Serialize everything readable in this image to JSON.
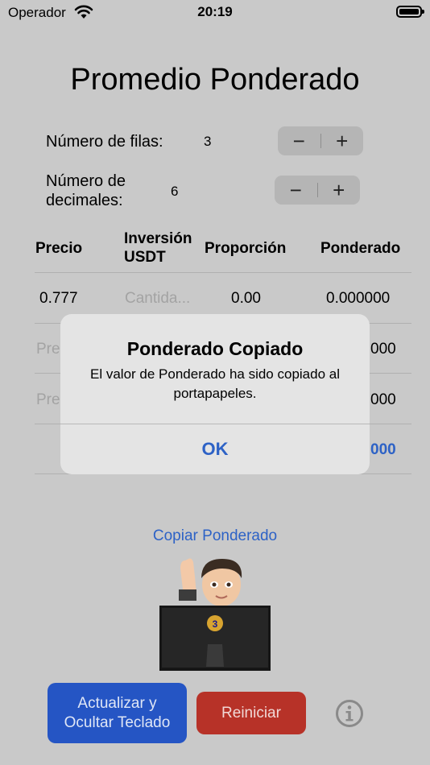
{
  "status_bar": {
    "carrier": "Operador",
    "time": "20:19",
    "wifi_icon": "wifi-icon",
    "battery_icon": "battery-icon"
  },
  "title": "Promedio Ponderado",
  "rows_setting": {
    "label": "Número de filas:",
    "value": "3",
    "minus": "−",
    "plus": "+"
  },
  "decimals_setting": {
    "label_line1": "Número de",
    "label_line2": "decimales:",
    "value": "6",
    "minus": "−",
    "plus": "+"
  },
  "table": {
    "headers": {
      "precio": "Precio",
      "inversion_line1": "Inversión",
      "inversion_line2": "USDT",
      "proporcion": "Proporción",
      "ponderado": "Ponderado"
    },
    "row1": {
      "precio": "0.777",
      "inversion_placeholder": "Cantida...",
      "proporcion": "0.00",
      "ponderado": "0.000000"
    },
    "row2": {
      "precio_placeholder": "Pre",
      "ponderado": "000"
    },
    "row3": {
      "precio_placeholder": "Pre",
      "ponderado": "000"
    },
    "total": {
      "ponderado": "000"
    }
  },
  "copy_link": "Copiar Ponderado",
  "buttons": {
    "update_line1": "Actualizar y",
    "update_line2": "Ocultar Teclado",
    "reset": "Reiniciar",
    "info_icon": "info-icon"
  },
  "alert": {
    "title": "Ponderado Copiado",
    "message": "El valor de Ponderado ha sido copiado al portapapeles.",
    "ok": "OK"
  },
  "colors": {
    "accent": "#2d62c6",
    "update_button": "#2555c4",
    "reset_button": "#b73228",
    "background": "#c9c9c9"
  }
}
